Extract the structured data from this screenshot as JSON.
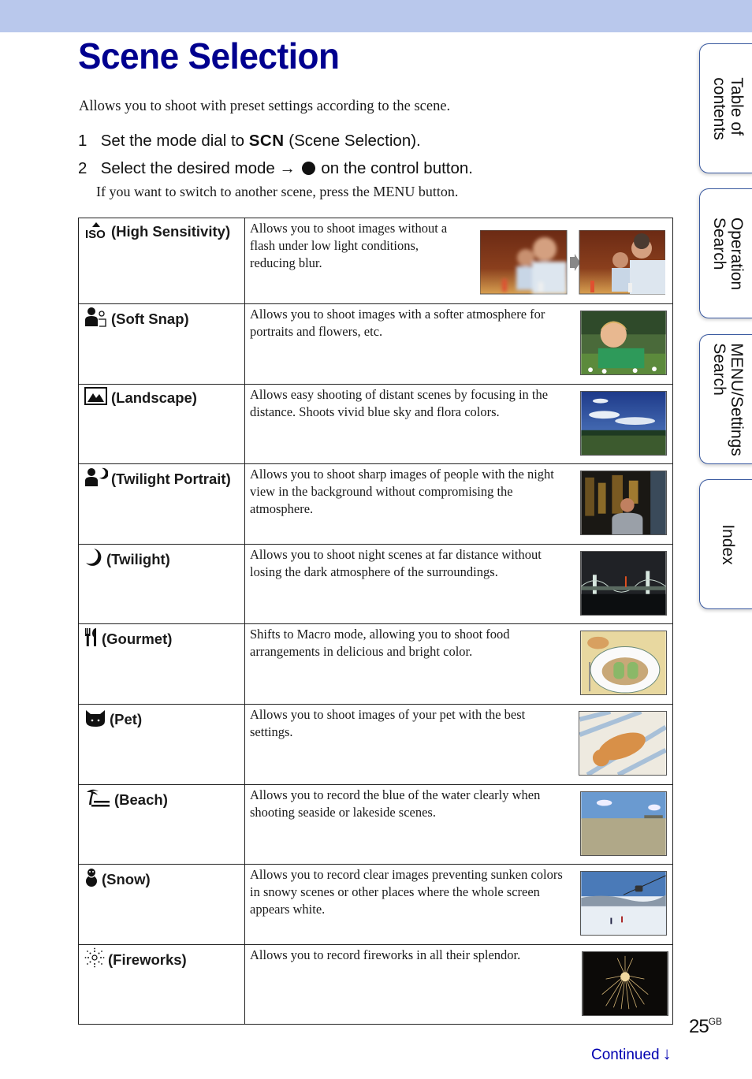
{
  "header": {
    "band_color": "#b9c8ec",
    "title": "Scene Selection",
    "title_color": "#00008f"
  },
  "intro": "Allows you to shoot with preset settings according to the scene.",
  "steps": [
    {
      "num": "1",
      "before": "Set the mode dial to",
      "symbol": "SCN",
      "after": "(Scene Selection)."
    },
    {
      "num": "2",
      "before": "Select the desired mode",
      "arrow": "→",
      "after": "on the control button."
    }
  ],
  "note": "If you want to switch to another scene, press the MENU button.",
  "modes": [
    {
      "icon": "high-sensitivity-iso-icon",
      "label": "(High Sensitivity)",
      "description": "Allows you to shoot images without a flash under low light conditions, reducing blur.",
      "image": "blurry-vs-sharp-dinner-photo-comparison"
    },
    {
      "icon": "soft-snap-icon",
      "label": "(Soft Snap)",
      "description": "Allows you to shoot images with a softer atmosphere for portraits and flowers, etc.",
      "image": "boy-in-flowers-photo"
    },
    {
      "icon": "landscape-icon",
      "label": "(Landscape)",
      "description": "Allows easy shooting of distant scenes by focusing in the distance. Shoots vivid blue sky and flora colors.",
      "image": "field-and-blue-sky-photo"
    },
    {
      "icon": "twilight-portrait-icon",
      "label": "(Twilight Portrait)",
      "description": "Allows you to shoot sharp images of people with the night view in the background without compromising the atmosphere.",
      "image": "man-with-night-city-photo"
    },
    {
      "icon": "twilight-moon-icon",
      "label": "(Twilight)",
      "description": "Allows you to shoot night scenes at far distance without losing the dark atmosphere of the surroundings.",
      "image": "night-bridge-photo"
    },
    {
      "icon": "gourmet-fork-knife-icon",
      "label": "(Gourmet)",
      "description": "Shifts to Macro mode, allowing you to shoot food arrangements in delicious and bright color.",
      "image": "plated-food-photo"
    },
    {
      "icon": "pet-cat-icon",
      "label": "(Pet)",
      "description": "Allows you to shoot images of your pet with the best settings.",
      "image": "cat-on-blanket-photo"
    },
    {
      "icon": "beach-palm-icon",
      "label": "(Beach)",
      "description": "Allows you to record the blue of the water clearly when shooting seaside or lakeside scenes.",
      "image": "shallow-sea-photo"
    },
    {
      "icon": "snow-snowman-icon",
      "label": "(Snow)",
      "description": "Allows you to record clear images preventing sunken colors in snowy scenes or other places where the whole screen appears white.",
      "image": "ski-slope-gondola-photo"
    },
    {
      "icon": "fireworks-icon",
      "label": "(Fireworks)",
      "description": "Allows you to record fireworks in all their splendor.",
      "image": "fireworks-photo"
    }
  ],
  "side_tabs": [
    {
      "line1": "Table of",
      "line2": "contents"
    },
    {
      "line1": "Operation",
      "line2": "Search"
    },
    {
      "line1": "MENU/Settings",
      "line2": "Search"
    },
    {
      "line1": "Index",
      "line2": ""
    }
  ],
  "footer": {
    "page_number": "25",
    "page_suffix": "GB",
    "continued": "Continued",
    "continued_arrow": "↓",
    "link_color": "#0000b0"
  }
}
